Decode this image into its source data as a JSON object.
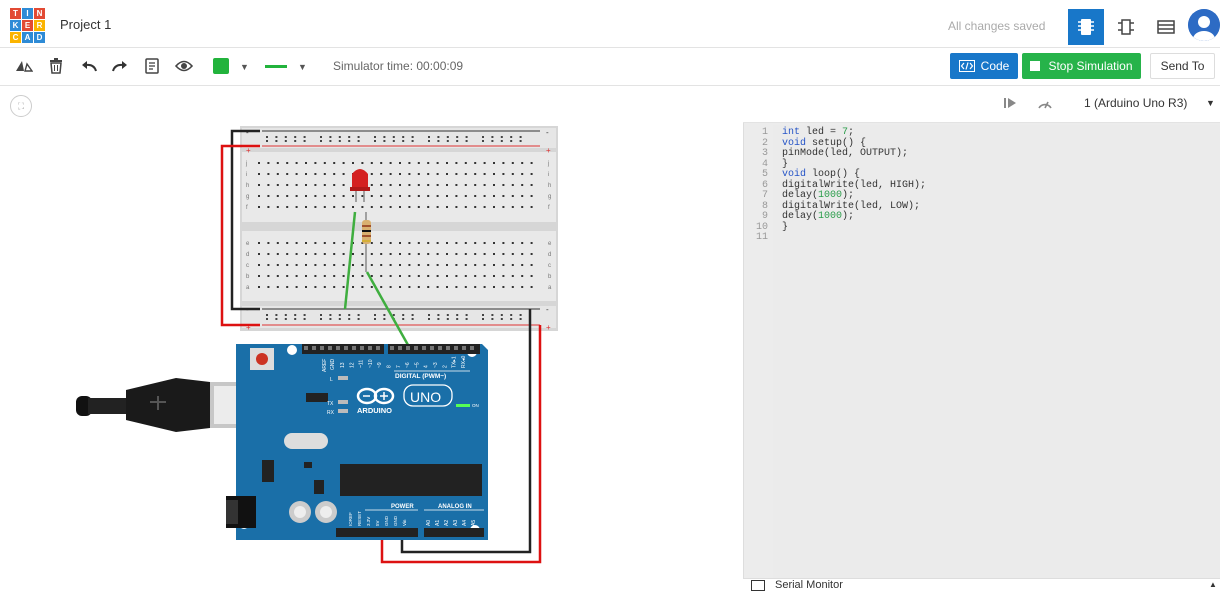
{
  "app": {
    "logo_letters": [
      "T",
      "I",
      "N",
      "K",
      "E",
      "R",
      "C",
      "A",
      "D"
    ],
    "logo_colors": [
      "#e24a34",
      "#2e8bd6",
      "#e24a34",
      "#2e8bd6",
      "#e24a34",
      "#fbb400",
      "#fbb400",
      "#2e8bd6",
      "#2e8bd6"
    ],
    "project_title": "Project 1",
    "save_status": "All changes saved"
  },
  "toolbar": {
    "simulator_time": "Simulator time: 00:00:09",
    "color_swatch": "#22b33c",
    "line_style": "solid",
    "code_label": "Code",
    "stop_label": "Stop Simulation",
    "send_label": "Send To"
  },
  "code_panel": {
    "device": "1 (Arduino Uno R3)",
    "lines": [
      "int led = 7;",
      "void setup() {",
      "pinMode(led, OUTPUT);",
      "}",
      "void loop() {",
      "digitalWrite(led, HIGH);",
      "delay(1000);",
      "digitalWrite(led, LOW);",
      "delay(1000);",
      "}",
      ""
    ],
    "serial_monitor": "Serial Monitor"
  },
  "circuit": {
    "board_labels": {
      "aref": "AREF",
      "gnd": "GND",
      "pins_digital": [
        "13",
        "12",
        "~11",
        "~10",
        "~9",
        "8",
        "7",
        "~6",
        "~5",
        "4",
        "~3",
        "2",
        "TX▸1",
        "RX◂0"
      ],
      "digital": "DIGITAL (PWM~)",
      "brand": "ARDUINO",
      "model": "UNO",
      "on": "ON",
      "led_l": "L",
      "tx": "TX",
      "rx": "RX",
      "power": "POWER",
      "analog": "ANALOG IN",
      "power_pins": [
        "IOREF",
        "RESET",
        "3.3V",
        "5V",
        "GND",
        "GND",
        "Vin"
      ],
      "analog_pins": [
        "A0",
        "A1",
        "A2",
        "A3",
        "A4",
        "A5"
      ]
    },
    "breadboard_letters_top": [
      "j",
      "i",
      "h",
      "g",
      "f"
    ],
    "breadboard_letters_bottom": [
      "e",
      "d",
      "c",
      "b",
      "a"
    ],
    "rail_minus": "-",
    "rail_plus": "+"
  }
}
